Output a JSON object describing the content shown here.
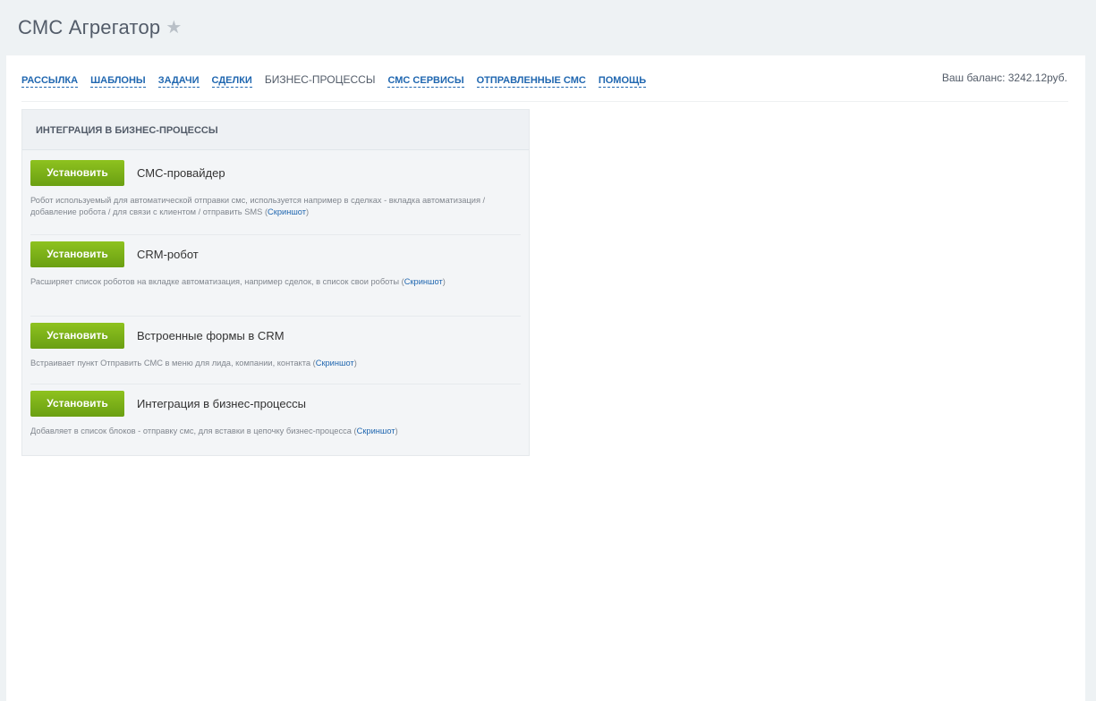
{
  "app": {
    "title": "СМС Агрегатор",
    "star_icon": "star-icon"
  },
  "nav": {
    "items": [
      {
        "label": "РАССЫЛКА",
        "active": false
      },
      {
        "label": "ШАБЛОНЫ",
        "active": false
      },
      {
        "label": "ЗАДАЧИ",
        "active": false
      },
      {
        "label": "СДЕЛКИ",
        "active": false
      },
      {
        "label": "БИЗНЕС-ПРОЦЕССЫ",
        "active": true
      },
      {
        "label": "СМС СЕРВИСЫ",
        "active": false
      },
      {
        "label": "ОТПРАВЛЕННЫЕ СМС",
        "active": false
      },
      {
        "label": "ПОМОЩЬ",
        "active": false
      }
    ],
    "balance": "Ваш баланс: 3242.12руб."
  },
  "panel": {
    "title": "ИНТЕГРАЦИЯ В БИЗНЕС-ПРОЦЕССЫ",
    "items": [
      {
        "button_label": "Установить",
        "name": "СМС-провайдер",
        "description": "Робот используемый для автоматической отправки смс, используется например в сделках - вкладка автоматизация / добавление робота / для связи с клиентом / отправить SMS (",
        "link_label": "Скриншот",
        "suffix": ")"
      },
      {
        "button_label": "Установить",
        "name": "CRM-робот",
        "description": "Расширяет список роботов на вкладке автоматизация, например сделок, в список свои роботы (",
        "link_label": "Скриншот",
        "suffix": ")"
      },
      {
        "button_label": "Установить",
        "name": "Встроенные формы в CRM",
        "description": "Встраивает пункт Отправить СМС в меню для лида, компании, контакта (",
        "link_label": "Скриншот",
        "suffix": ")"
      },
      {
        "button_label": "Установить",
        "name": "Интеграция в бизнес-процессы",
        "description": "Добавляет в список блоков - отправку смс, для вставки в цепочку бизнес-процесса (",
        "link_label": "Скриншот",
        "suffix": ")"
      }
    ]
  },
  "colors": {
    "accent_link": "#2067b0",
    "button_green": "#7bb31a",
    "text": "#535c69"
  }
}
